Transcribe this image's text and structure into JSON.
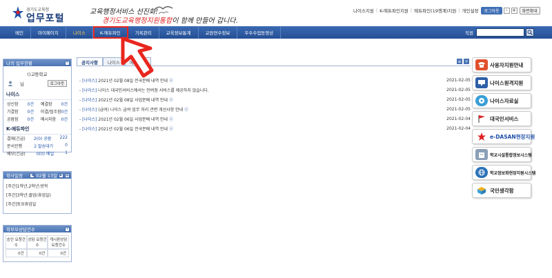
{
  "header": {
    "logo_small": "경기도교육청",
    "logo_big": "업무포털",
    "slogan_line1": "교육행정서비스 선진화!",
    "slogan_line2_red": "경기도교육행정지원통합",
    "slogan_line2_rest": "이 함께 만들어 갑니다.",
    "util_links": [
      "나이스지원",
      "K-에듀파인지원",
      "에듀파인(19행계)지원",
      "개인설정"
    ],
    "logout_label": "로그아웃",
    "zoom_label": "화면확대",
    "font_minus": "-",
    "font_plus": "+"
  },
  "nav": {
    "items": [
      "메인",
      "마이페이지",
      "나이스",
      "K-에듀파인",
      "기록관리",
      "교육정보통계",
      "교원연수정보",
      "우수수업동영상"
    ],
    "search_label": "직원",
    "search_value": ""
  },
  "left": {
    "work_title": "나의 업무현황",
    "school": "()고등학교",
    "user": "님",
    "logout": "로그아웃",
    "neis_title": "나이스",
    "neis_rows": [
      {
        "label": "상신함",
        "value": "0건"
      },
      {
        "label": "예결함",
        "value": "0건"
      },
      {
        "label": "기결함",
        "value": "0건"
      },
      {
        "label": "미결/협조함",
        "value": "0건"
      },
      {
        "label": "공람함",
        "value": "0건"
      },
      {
        "label": "메시지함",
        "value": "0건"
      }
    ],
    "edufine_title": "K-에듀파인",
    "edufine_rows": [
      {
        "label": "결재(긴급)",
        "value": "2(0) 공람",
        "extra": "222"
      },
      {
        "label": "문서진행",
        "value": "2 발송대기",
        "extra": "0"
      },
      {
        "label": "메모(긴급)",
        "value": "0(0) 메일",
        "extra": "1"
      }
    ],
    "sched_title": "학사일정",
    "sched_date": "02월 13일",
    "sched_items": [
      "[주간]1학년,2학년:방학",
      "[주간]3학년:졸업(휴업일)",
      "[주간]토요휴업일"
    ],
    "counsel_title": "학부모상담건수",
    "counsel_headers": [
      "승인 요청건수",
      "상담 요청건수",
      "게시판상담 요청건수"
    ],
    "counsel_values": [
      "0건",
      "0건",
      "0건"
    ]
  },
  "content": {
    "tabs": [
      "공지사항",
      "나이스",
      "에듀파인"
    ],
    "news": [
      {
        "tag": "[나이스]",
        "text": "2021년 02월 08일 전국문배 내역 안내",
        "date": "2021-02-05"
      },
      {
        "tag": "[나이스]",
        "text": "나이스 대국민서비스에서는 인버정 서비스를 제공하지 않습니다.",
        "date": "2021-02-05"
      },
      {
        "tag": "[나이스]",
        "text": "2021년 02월 08일 사업문배 내역 안내",
        "date": "2021-02-05"
      },
      {
        "tag": "[나이스]",
        "text": "(급여) 나이스 급여 업무 처리 관련 개선사항 안내",
        "date": "2021-02-05"
      },
      {
        "tag": "[나이스]",
        "text": "2021년 02월 06일 사업문배 내역 안내",
        "date": "2021-02-04"
      },
      {
        "tag": "[나이스]",
        "text": "2021년 02월 06일 전국문배 내역 안내",
        "date": "2021-02-04"
      }
    ]
  },
  "banners": [
    {
      "label": "사용자지원안내",
      "icon": "phone-icon",
      "color": "#e0502c"
    },
    {
      "label": "나이스원격지원",
      "icon": "monitor-icon",
      "color": "#2e5fa8"
    },
    {
      "label": "나이스자료실",
      "icon": "disk-icon",
      "color": "#3a9fd6"
    },
    {
      "label": "대국민서비스",
      "icon": "flag-icon",
      "color": "#d9262c"
    },
    {
      "label": "e-DASAN현장지원",
      "icon": "star-icon",
      "color": "#1e4fa8"
    },
    {
      "label": "학교시설통합정보시스템",
      "icon": "building-icon",
      "color": "#8aa0b8"
    },
    {
      "label": "학교정보화현장지원시스템",
      "icon": "globe-icon",
      "color": "#2c72b8"
    },
    {
      "label": "국민생각함",
      "icon": "box-icon",
      "color": "#f0b020"
    }
  ],
  "colors": {
    "nav": "#2f5ea3",
    "accent_red": "#e8261d"
  }
}
